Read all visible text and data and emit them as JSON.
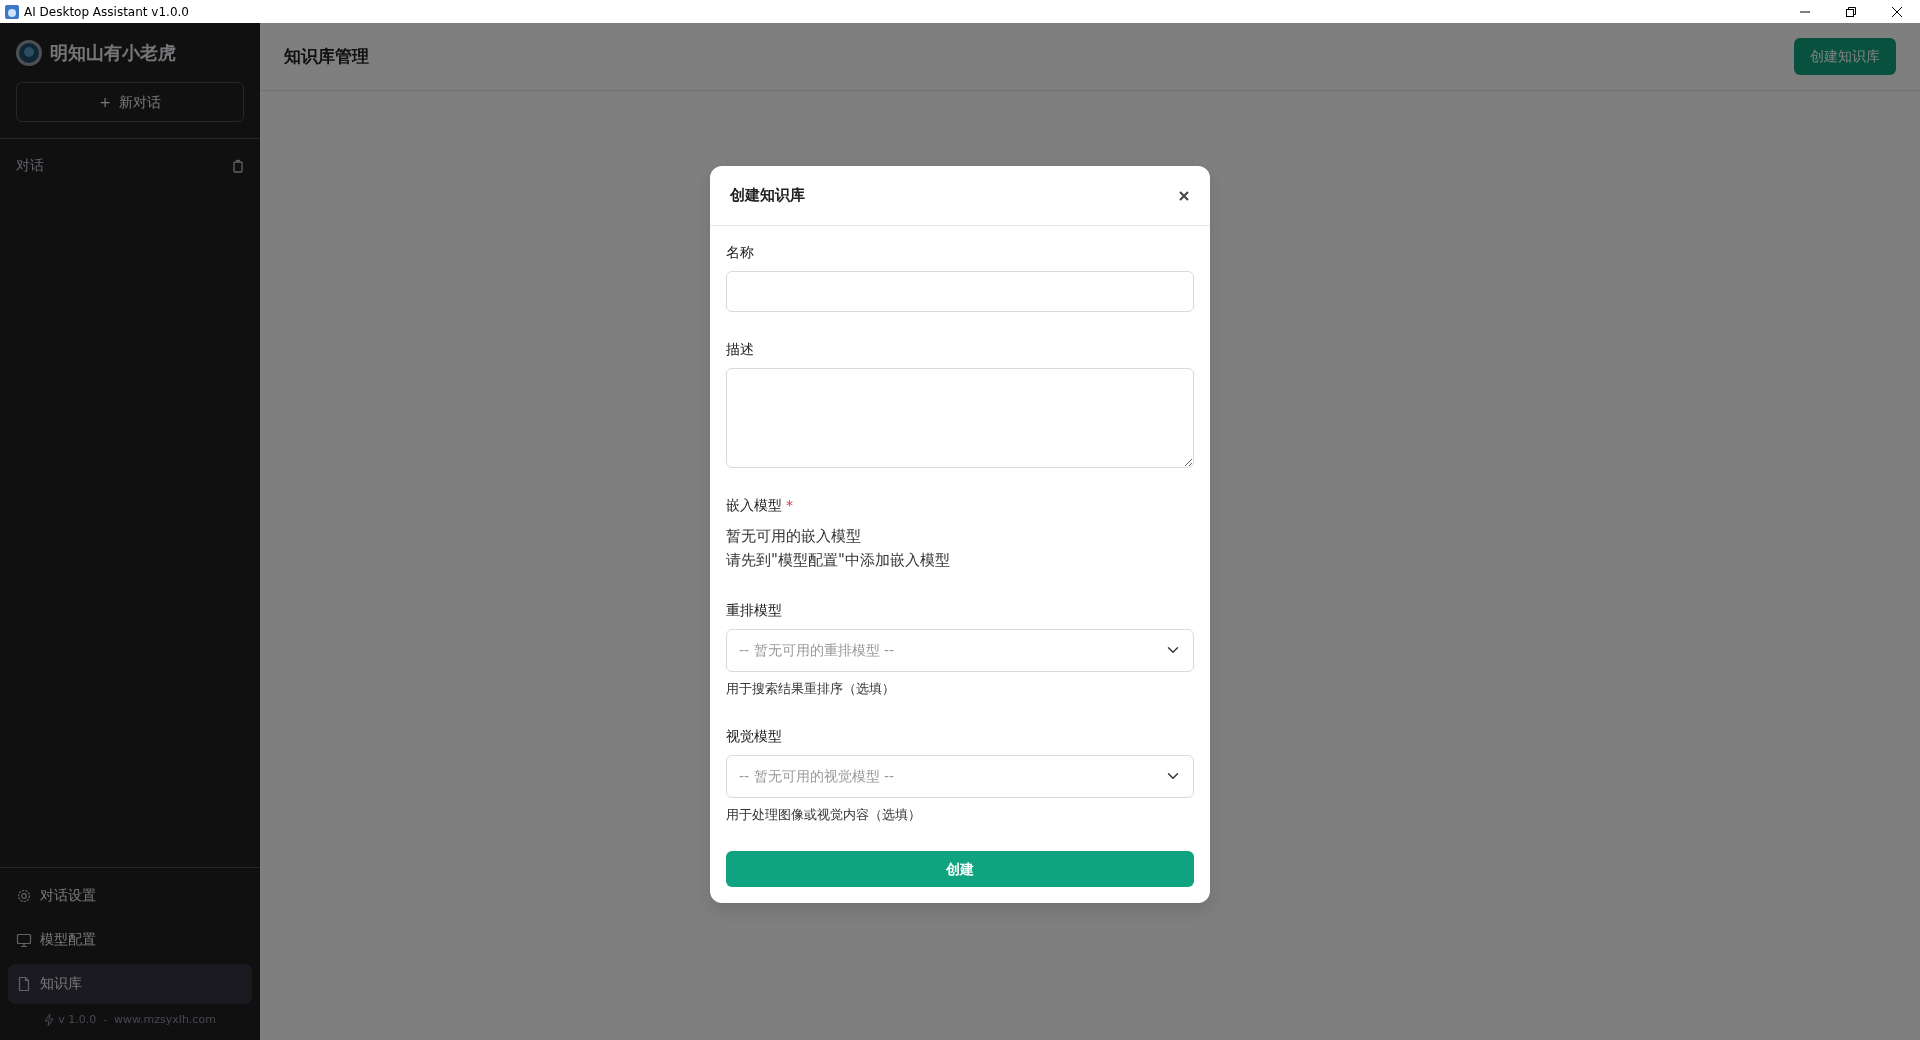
{
  "window": {
    "title": "AI Desktop Assistant v1.0.0"
  },
  "sidebar": {
    "brand": "明知山有小老虎",
    "new_chat": {
      "icon": "+",
      "label": "新对话"
    },
    "section": {
      "label": "对话"
    },
    "nav": [
      {
        "label": "对话设置",
        "selected": false
      },
      {
        "label": "模型配置",
        "selected": false
      },
      {
        "label": "知识库",
        "selected": true
      }
    ],
    "footer": "v 1.0.0  -  www.mzsyxlh.com"
  },
  "header": {
    "title": "知识库管理",
    "button": "创建知识库"
  },
  "modal": {
    "title": "创建知识库",
    "fields": [
      {
        "kind": "input",
        "label": "名称"
      },
      {
        "kind": "textarea",
        "label": "描述"
      },
      {
        "kind": "notice",
        "label": "嵌入模型",
        "required_mark": "*",
        "lines": [
          "暂无可用的嵌入模型",
          "请先到\"模型配置\"中添加嵌入模型"
        ]
      },
      {
        "kind": "select",
        "label": "重排模型",
        "placeholder": "-- 暂无可用的重排模型 --",
        "help": "用于搜索结果重排序（选填）"
      },
      {
        "kind": "select",
        "label": "视觉模型",
        "placeholder": "-- 暂无可用的视觉模型 --",
        "help": "用于处理图像或视觉内容（选填）"
      }
    ],
    "submit": "创建"
  }
}
